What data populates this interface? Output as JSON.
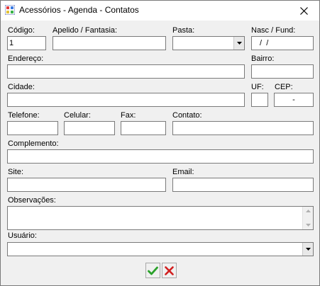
{
  "window": {
    "title": "Acessórios - Agenda - Contatos",
    "icon": "app-icon",
    "close_icon": "close-icon"
  },
  "form": {
    "codigo": {
      "label": "Código:",
      "value": "1"
    },
    "apelido": {
      "label": "Apelido / Fantasia:",
      "value": ""
    },
    "pasta": {
      "label": "Pasta:",
      "value": ""
    },
    "nasc": {
      "label": "Nasc / Fund:",
      "value": " /  /"
    },
    "endereco": {
      "label": "Endereço:",
      "value": ""
    },
    "bairro": {
      "label": "Bairro:",
      "value": ""
    },
    "cidade": {
      "label": "Cidade:",
      "value": ""
    },
    "uf": {
      "label": "UF:",
      "value": ""
    },
    "cep": {
      "label": "CEP:",
      "value": "-"
    },
    "telefone": {
      "label": "Telefone:",
      "value": ""
    },
    "celular": {
      "label": "Celular:",
      "value": ""
    },
    "fax": {
      "label": "Fax:",
      "value": ""
    },
    "contato": {
      "label": "Contato:",
      "value": ""
    },
    "complemento": {
      "label": "Complemento:",
      "value": ""
    },
    "site": {
      "label": "Site:",
      "value": ""
    },
    "email": {
      "label": "Email:",
      "value": ""
    },
    "observacoes": {
      "label": "Observações:",
      "value": ""
    },
    "usuario": {
      "label": "Usuário:",
      "value": ""
    }
  },
  "buttons": {
    "confirm_icon": "check-icon",
    "cancel_icon": "x-icon"
  },
  "colors": {
    "confirm": "#2aa12a",
    "cancel": "#d11f1f",
    "border": "#7a7a7a",
    "background": "#f0f0f0"
  }
}
